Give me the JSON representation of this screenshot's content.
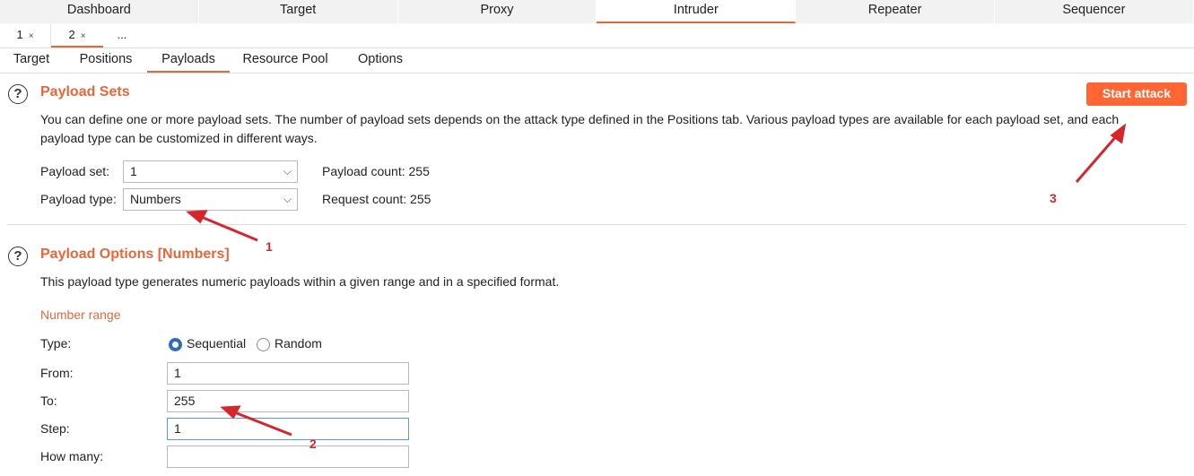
{
  "top_tabs": [
    "Dashboard",
    "Target",
    "Proxy",
    "Intruder",
    "Repeater",
    "Sequencer"
  ],
  "instance_tabs": [
    {
      "label": "1",
      "close": "×"
    },
    {
      "label": "2",
      "close": "×"
    },
    {
      "label": "..."
    }
  ],
  "sub_tabs": [
    "Target",
    "Positions",
    "Payloads",
    "Resource Pool",
    "Options"
  ],
  "payload_sets": {
    "title": "Payload Sets",
    "help_glyph": "?",
    "description_line1": "You can define one or more payload sets. The number of payload sets depends on the attack type defined in the Positions tab. Various payload types are available for each payload set, and each",
    "description_line2": "payload type can be customized in different ways.",
    "payload_set_label": "Payload set:",
    "payload_set_value": "1",
    "payload_type_label": "Payload type:",
    "payload_type_value": "Numbers",
    "payload_count": "Payload count: 255",
    "request_count": "Request count: 255",
    "start_attack": "Start attack"
  },
  "payload_options": {
    "title": "Payload Options [Numbers]",
    "help_glyph": "?",
    "description": "This payload type generates numeric payloads within a given range and in a specified format.",
    "number_range_heading": "Number range",
    "type_label": "Type:",
    "sequential_label": "Sequential",
    "random_label": "Random",
    "from_label": "From:",
    "from_value": "1",
    "to_label": "To:",
    "to_value": "255",
    "step_label": "Step:",
    "step_value": "1",
    "how_many_label": "How many:",
    "how_many_value": ""
  },
  "annotations": [
    "1",
    "2",
    "3"
  ],
  "colors": {
    "accent": "#e8673a",
    "button": "#ff6633",
    "annotation": "#d7262b",
    "radio": "#2d6fb7"
  },
  "icons": {
    "chevron": "chevron-down-icon",
    "help": "help-circle-icon"
  }
}
